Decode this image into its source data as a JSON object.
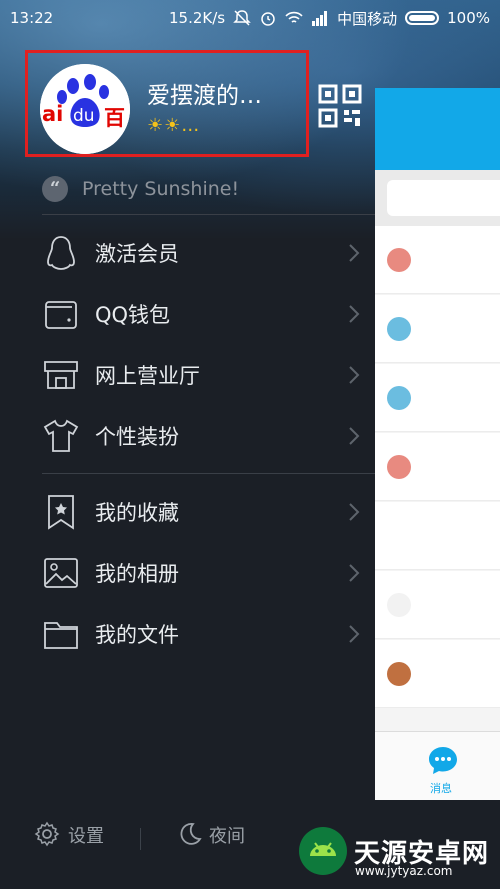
{
  "status_bar": {
    "time": "13:22",
    "speed": "15.2K/s",
    "carrier": "中国移动",
    "battery": "100%"
  },
  "profile": {
    "nickname": "爱摆渡的…",
    "level_icons": "☀☀…",
    "avatar_text_left": "ai",
    "avatar_text_mid": "du",
    "avatar_text_right": "百"
  },
  "quote": {
    "mark": "“",
    "text": "Pretty Sunshine!"
  },
  "menu": {
    "items": [
      {
        "label": "激活会员",
        "icon": "penguin-icon"
      },
      {
        "label": "QQ钱包",
        "icon": "wallet-icon"
      },
      {
        "label": "网上营业厅",
        "icon": "store-icon"
      },
      {
        "label": "个性装扮",
        "icon": "tshirt-icon"
      },
      {
        "label": "我的收藏",
        "icon": "bookmark-star-icon"
      },
      {
        "label": "我的相册",
        "icon": "photo-icon"
      },
      {
        "label": "我的文件",
        "icon": "folder-icon"
      }
    ]
  },
  "bottom": {
    "settings_label": "设置",
    "night_label": "夜间"
  },
  "main_panel": {
    "tab_label": "消息"
  },
  "watermark": {
    "title": "天源安卓网",
    "url": "www.jytyaz.com"
  },
  "colors": {
    "accent": "#12a8e8",
    "highlight_border": "#e02020",
    "drawer_bg": "#1b1f26"
  }
}
